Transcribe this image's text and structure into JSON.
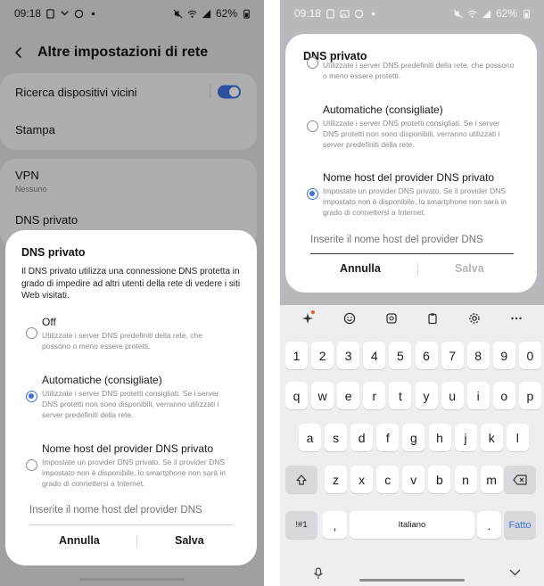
{
  "left": {
    "status": {
      "time": "09:18",
      "battery": "62%"
    },
    "header": {
      "title": "Altre impostazioni di rete"
    },
    "rows": {
      "nearby": "Ricerca dispositivi vicini",
      "print": "Stampa",
      "vpn": "VPN",
      "vpn_sub": "Nessuno",
      "dns": "DNS privato"
    },
    "dialog": {
      "title": "DNS privato",
      "description": "Il DNS privato utilizza una connessione DNS protetta in grado di impedire ad altri utenti della rete di vedere i siti Web visitati.",
      "options": [
        {
          "title": "Off",
          "sub": "Utilizzate i server DNS predefiniti della rete, che possono o meno essere protetti."
        },
        {
          "title": "Automatiche (consigliate)",
          "sub": "Utilizzate i server DNS protetti consigliati. Se i server DNS protetti non sono disponibili, verranno utilizzati i server predefiniti della rete."
        },
        {
          "title": "Nome host del provider DNS privato",
          "sub": "Impostate un provider DNS privato. Se il provider DNS impostato non è disponibile, lo smartphone non sarà in grado di connettersi a Internet."
        }
      ],
      "input_placeholder": "Inserite il nome host del provider DNS",
      "cancel": "Annulla",
      "save": "Salva"
    }
  },
  "right": {
    "status": {
      "time": "09:18",
      "battery": "62%"
    },
    "dialog": {
      "title": "DNS privato",
      "options": [
        {
          "sub": "Utilizzate i server DNS predefiniti della rete, che possono o meno essere protetti."
        },
        {
          "title": "Automatiche (consigliate)",
          "sub": "Utilizzate i server DNS protetti consigliati. Se i server DNS protetti non sono disponibili, verranno utilizzati i server predefiniti della rete."
        },
        {
          "title": "Nome host del provider DNS privato",
          "sub": "Impostate un provider DNS privato. Se il provider DNS impostato non è disponibile, lo smartphone non sarà in grado di connettersi a Internet."
        }
      ],
      "input_placeholder": "Inserite il nome host del provider DNS",
      "cancel": "Annulla",
      "save": "Salva"
    },
    "keyboard": {
      "row1": [
        "1",
        "2",
        "3",
        "4",
        "5",
        "6",
        "7",
        "8",
        "9",
        "0"
      ],
      "row2": [
        "q",
        "w",
        "e",
        "r",
        "t",
        "y",
        "u",
        "i",
        "o",
        "p"
      ],
      "row3": [
        "a",
        "s",
        "d",
        "f",
        "g",
        "h",
        "j",
        "k",
        "l"
      ],
      "row4": [
        "z",
        "x",
        "c",
        "v",
        "b",
        "n",
        "m"
      ],
      "symbols": "!#1",
      "comma": ",",
      "space": "Italiano",
      "period": ".",
      "done": "Fatto"
    }
  },
  "colors": {
    "accent": "#3f6fd8"
  }
}
